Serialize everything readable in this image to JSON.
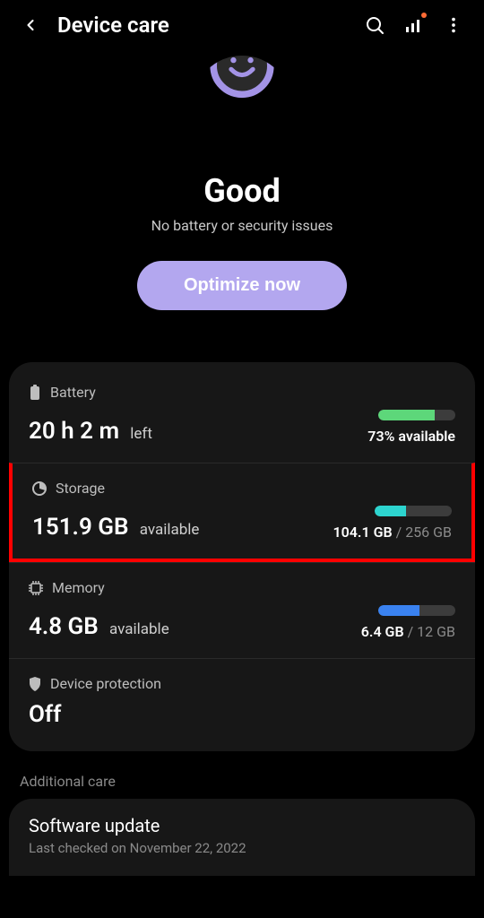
{
  "header": {
    "title": "Device care"
  },
  "hero": {
    "status": "Good",
    "subtitle": "No battery or security issues",
    "optimize_label": "Optimize now"
  },
  "battery": {
    "label": "Battery",
    "value": "20 h 2 m",
    "value_suffix": "left",
    "right_text": "73% available",
    "fill_percent": 73,
    "fill_color": "#5dd77a"
  },
  "storage": {
    "label": "Storage",
    "value": "151.9 GB",
    "value_suffix": "available",
    "used": "104.1 GB",
    "total": "256 GB",
    "fill_percent": 41,
    "fill_color": "#2dd4cf",
    "highlighted": true
  },
  "memory": {
    "label": "Memory",
    "value": "4.8 GB",
    "value_suffix": "available",
    "used": "6.4 GB",
    "total": "12 GB",
    "fill_percent": 53,
    "fill_color": "#3a82f0"
  },
  "protection": {
    "label": "Device protection",
    "value": "Off"
  },
  "additional": {
    "section_label": "Additional care",
    "software_update_title": "Software update",
    "software_update_sub": "Last checked on November 22, 2022"
  },
  "colors": {
    "accent": "#a393e6"
  }
}
